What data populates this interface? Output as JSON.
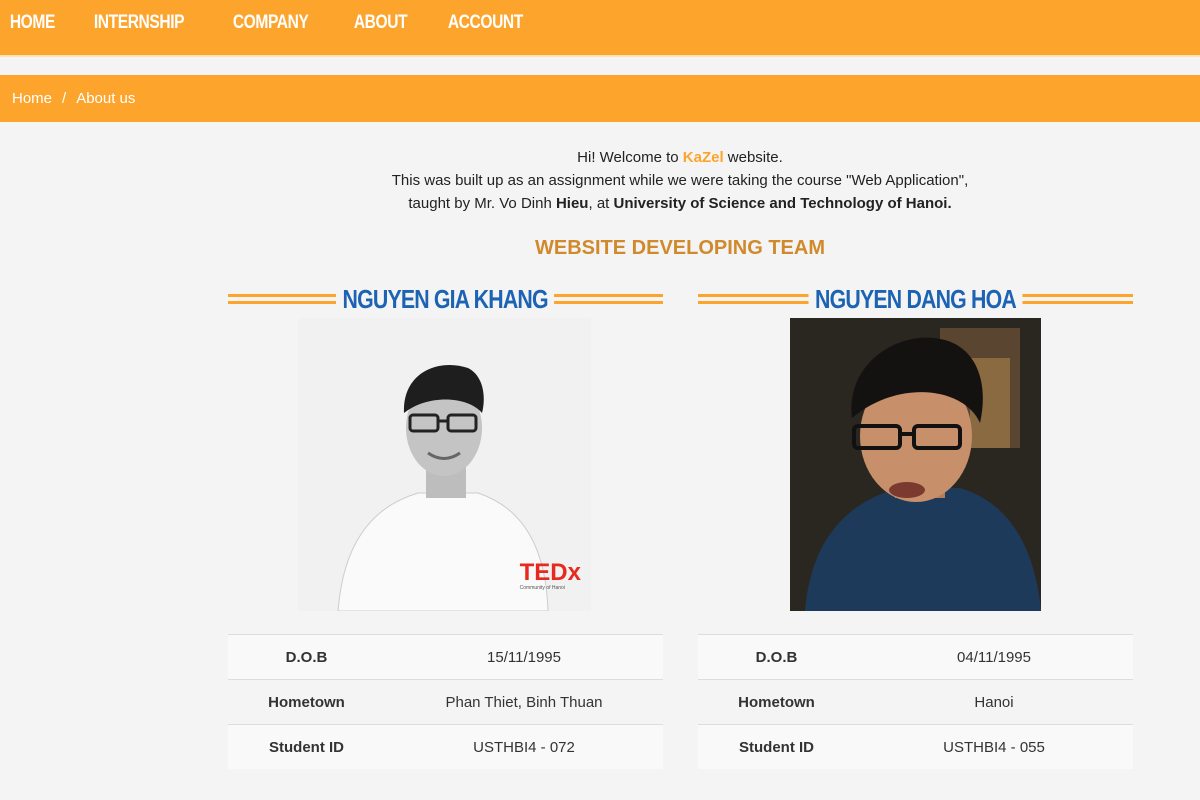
{
  "nav": {
    "items": [
      {
        "label": "HOME"
      },
      {
        "label": "INTERNSHIP"
      },
      {
        "label": "COMPANY"
      },
      {
        "label": "ABOUT"
      },
      {
        "label": "ACCOUNT"
      }
    ]
  },
  "breadcrumb": {
    "home": "Home",
    "separator": "/",
    "current": "About us"
  },
  "intro": {
    "line1_pre": "Hi! Welcome to ",
    "brand": "KaZel",
    "line1_post": " website.",
    "line2": "This was built up as an assignment while we were taking the course \"Web Application\",",
    "line3_pre": "taught by Mr. Vo Dinh ",
    "teacher_bold": "Hieu",
    "line3_mid": ", at ",
    "university": "University of Science and Technology of Hanoi."
  },
  "team_title": "WEBSITE DEVELOPING TEAM",
  "members": [
    {
      "name": "NGUYEN GIA KHANG",
      "photo_badge": "TEDx",
      "photo_badge_sub": "Community of Hanoi",
      "rows": [
        {
          "key": "D.O.B",
          "value": "15/11/1995"
        },
        {
          "key": "Hometown",
          "value": "Phan Thiet, Binh Thuan"
        },
        {
          "key": "Student ID",
          "value": "USTHBI4 - 072"
        }
      ]
    },
    {
      "name": "NGUYEN DANG HOA",
      "rows": [
        {
          "key": "D.O.B",
          "value": "04/11/1995"
        },
        {
          "key": "Hometown",
          "value": "Hanoi"
        },
        {
          "key": "Student ID",
          "value": "USTHBI4 - 055"
        }
      ]
    }
  ],
  "colors": {
    "accent": "#fda42c",
    "name_blue": "#1d63b3",
    "title_gold": "#d08a2c",
    "tedx_red": "#e62b1e"
  }
}
